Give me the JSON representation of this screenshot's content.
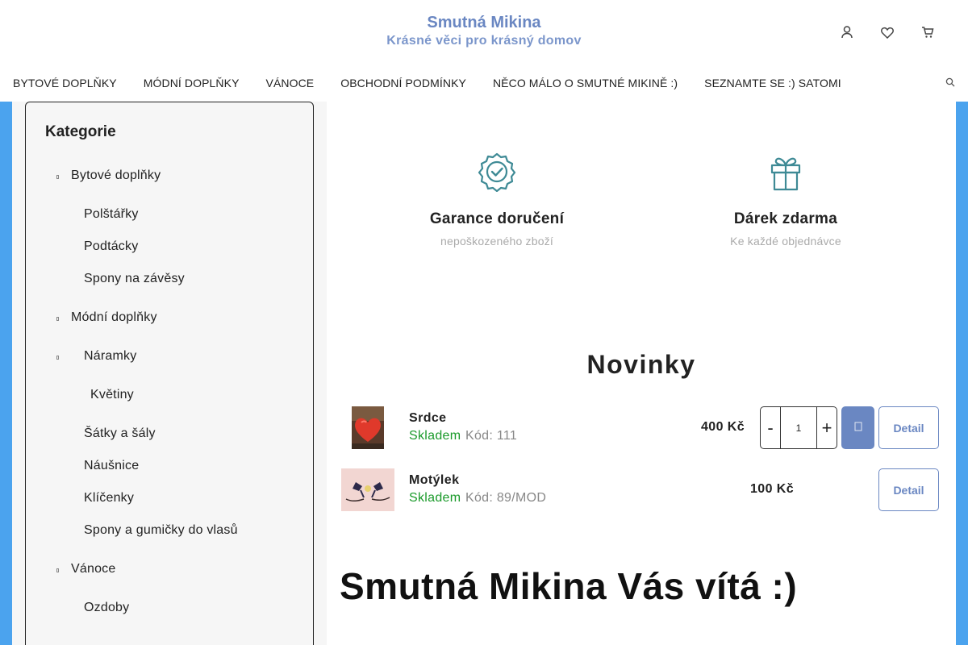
{
  "header": {
    "title": "Smutná Mikina",
    "subtitle": "Krásné věci pro krásný domov",
    "icons": [
      "user-icon",
      "heart-icon",
      "cart-icon"
    ]
  },
  "nav": {
    "items": [
      "BYTOVÉ DOPLŇKY",
      "MÓDNÍ DOPLŇKY",
      "VÁNOCE",
      "OBCHODNÍ PODMÍNKY",
      "NĚCO MÁLO O SMUTNÉ MIKINĚ :)",
      "SEZNAMTE SE :) SATOMI"
    ]
  },
  "sidebar": {
    "title": "Kategorie",
    "items": [
      "Bytové doplňky",
      "Polštářky",
      "Podtácky",
      "Spony na závěsy",
      "Módní doplňky",
      "Náramky",
      "Květiny",
      "Šátky a šály",
      "Náušnice",
      "Klíčenky",
      "Spony a gumičky do vlasů",
      "Vánoce",
      "Ozdoby"
    ]
  },
  "features": [
    {
      "icon": "badge-check-icon",
      "title": "Garance doručení",
      "sub": "nepoškozeného zboží"
    },
    {
      "icon": "gift-icon",
      "title": "Dárek zdarma",
      "sub": "Ke každé objednávce"
    }
  ],
  "novinky": {
    "title": "Novinky",
    "products": [
      {
        "name": "Srdce",
        "stock": "Skladem",
        "code": "Kód: 111",
        "price": "400 Kč",
        "qty": "1",
        "minus": "-",
        "plus": "+",
        "detail": "Detail"
      },
      {
        "name": "Motýlek",
        "stock": "Skladem",
        "code": "Kód: 89/MOD",
        "price": "100 Kč",
        "detail": "Detail"
      }
    ]
  },
  "welcome": "Smutná Mikina Vás vítá :)",
  "colors": {
    "brand": "#6a87c2",
    "stripe": "#4ba3ee",
    "stock": "#1a9a2a",
    "feature_icon": "#3e8a95"
  }
}
